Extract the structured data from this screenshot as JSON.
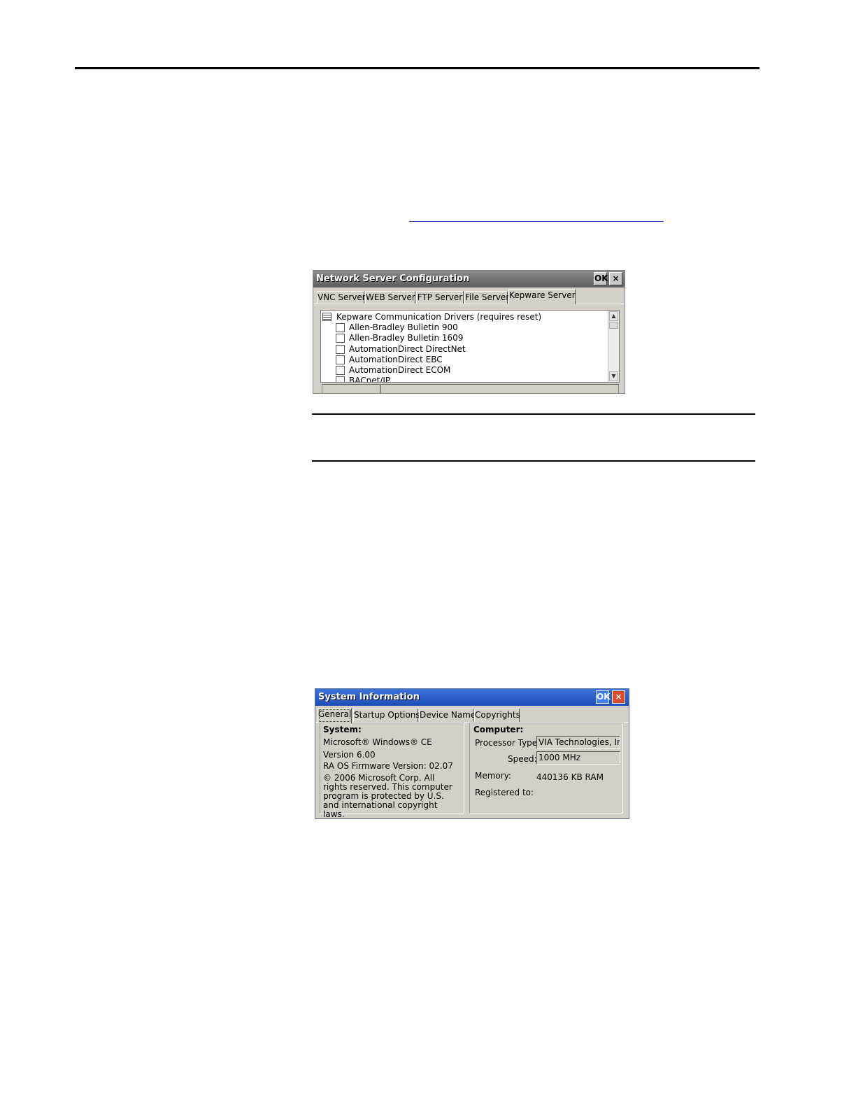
{
  "network_window": {
    "title": "Network Server Configuration",
    "ok_label": "OK",
    "close_label": "×",
    "tabs": [
      {
        "label": "VNC Server"
      },
      {
        "label": "WEB Server"
      },
      {
        "label": "FTP Server"
      },
      {
        "label": "File Server"
      },
      {
        "label": "Kepware Server"
      }
    ],
    "active_tab": "Kepware Server",
    "list_header": "Kepware Communication Drivers (requires reset)",
    "drivers": [
      {
        "label": "Allen-Bradley Bulletin 900",
        "checked": false
      },
      {
        "label": "Allen-Bradley Bulletin 1609",
        "checked": false
      },
      {
        "label": "AutomationDirect DirectNet",
        "checked": false
      },
      {
        "label": "AutomationDirect EBC",
        "checked": false
      },
      {
        "label": "AutomationDirect ECOM",
        "checked": false
      },
      {
        "label": "BACnet/IP",
        "checked": false
      }
    ]
  },
  "system_window": {
    "title": "System Information",
    "ok_label": "OK",
    "close_label": "×",
    "tabs": [
      {
        "label": "General"
      },
      {
        "label": "Startup Options"
      },
      {
        "label": "Device Name"
      },
      {
        "label": "Copyrights"
      }
    ],
    "active_tab": "General",
    "system": {
      "heading": "System:",
      "os": "Microsoft® Windows® CE",
      "version": "Version 6.00",
      "firmware": "RA OS Firmware Version: 02.07",
      "copyright": "© 2006 Microsoft Corp. All rights reserved. This computer program is protected by U.S. and international copyright laws."
    },
    "computer": {
      "heading": "Computer:",
      "processor_label": "Processor Type:",
      "processor_value": "VIA Technologies, In",
      "speed_label": "Speed:",
      "speed_value": "1000 MHz",
      "memory_label": "Memory:",
      "memory_value": "440136 KB  RAM",
      "registered_label": "Registered to:"
    }
  }
}
